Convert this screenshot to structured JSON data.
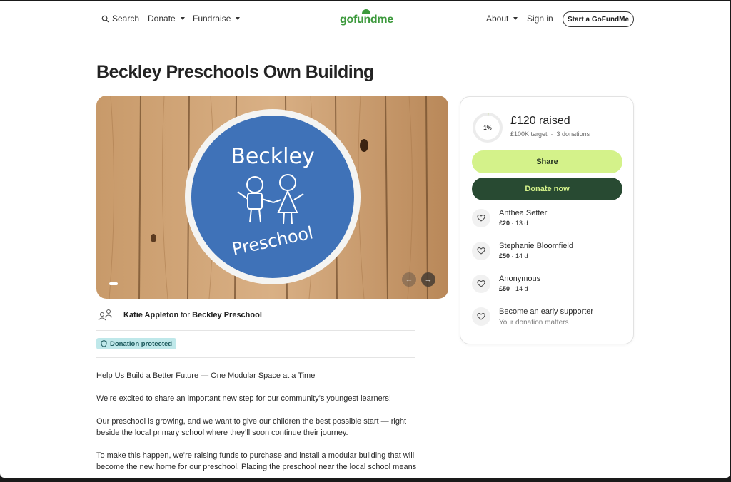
{
  "header": {
    "search_label": "Search",
    "donate_label": "Donate",
    "fundraise_label": "Fundraise",
    "logo_text": "gofundme",
    "about_label": "About",
    "signin_label": "Sign in",
    "start_label": "Start a GoFundMe"
  },
  "campaign": {
    "title": "Beckley Preschools Own Building",
    "image_sign_top": "Beckley",
    "image_sign_bottom": "Preschool",
    "organizer": "Katie Appleton",
    "for_word": "for",
    "beneficiary": "Beckley Preschool",
    "protected_label": "Donation protected",
    "story": [
      "Help Us Build a Better Future — One Modular Space at a Time",
      "We’re excited to share an important new step for our community’s youngest learners!",
      "Our preschool is growing, and we want to give our children the best possible start — right beside the local primary school where they’ll soon continue their journey.",
      "To make this happen, we’re raising funds to purchase and install a modular building that will become the new home for our preschool. Placing the preschool near the local school means"
    ]
  },
  "progress": {
    "percent_label": "1%",
    "fraction": 0.01,
    "raised": "£120 raised",
    "target": "£100K target",
    "donations": "3 donations"
  },
  "actions": {
    "share": "Share",
    "donate": "Donate now"
  },
  "donors": [
    {
      "name": "Anthea Setter",
      "amount": "£20",
      "time": " · 13 d"
    },
    {
      "name": "Stephanie Bloomfield",
      "amount": "£50",
      "time": " · 14 d"
    },
    {
      "name": "Anonymous",
      "amount": "£50",
      "time": " · 14 d"
    }
  ],
  "early": {
    "title": "Become an early supporter",
    "subtitle": "Your donation matters"
  },
  "colors": {
    "brand_green": "#3d9a3d",
    "share_bg": "#d4f28a",
    "donate_bg": "#284a32",
    "protected_bg": "#bfe8ea"
  }
}
